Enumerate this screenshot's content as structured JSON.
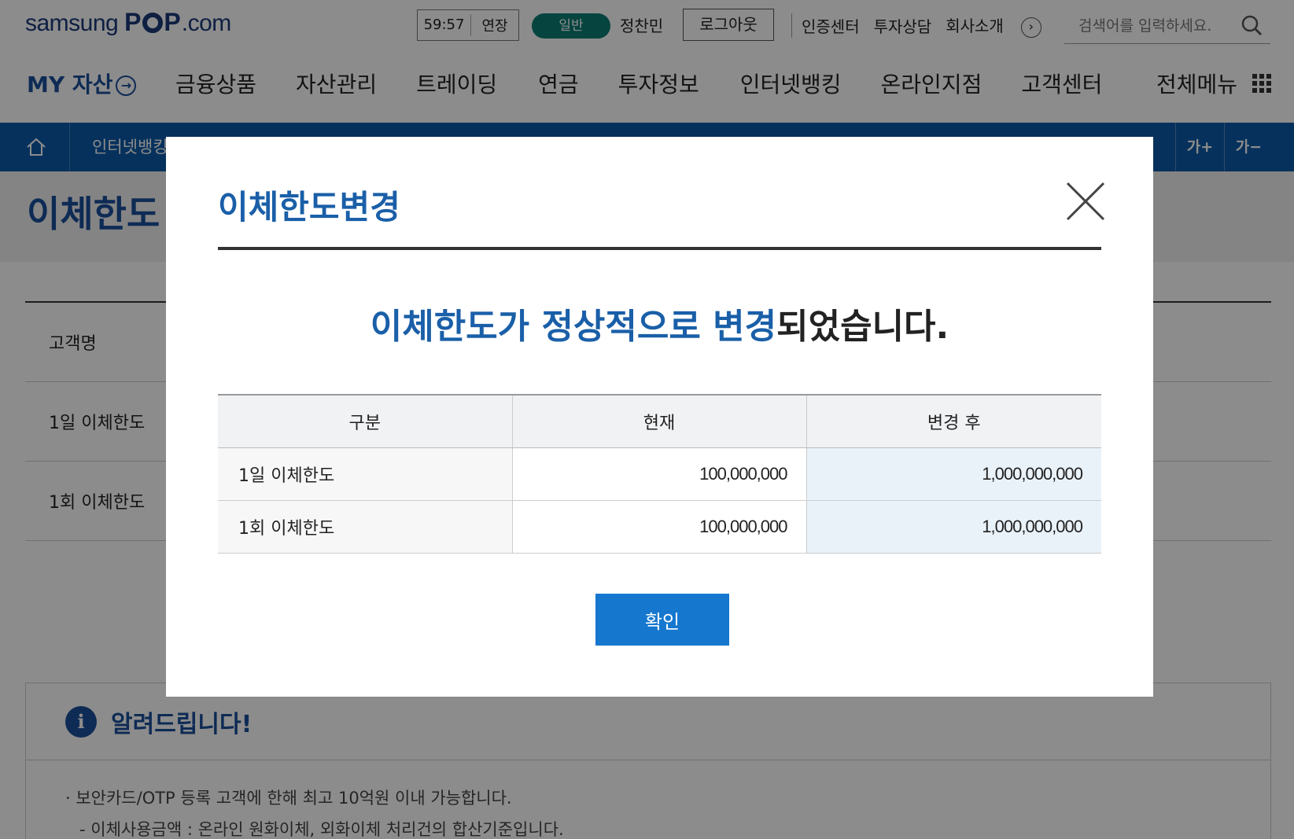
{
  "header": {
    "logo": "samsung POP.com",
    "logo_prefix": "samsung ",
    "logo_p1": "P",
    "logo_p2": "P",
    "logo_suffix": ".com",
    "session_timer": "59:57",
    "extend_label": "연장",
    "user_grade_badge": "일반",
    "user_name": "정찬민",
    "logout_label": "로그아웃",
    "util_links": [
      "인증센터",
      "투자상담",
      "회사소개"
    ],
    "search_placeholder": "검색어를 입력하세요."
  },
  "gnb": {
    "my_asset_label": "MY 자산",
    "menu": [
      "금융상품",
      "자산관리",
      "트레이딩",
      "연금",
      "투자정보",
      "인터넷뱅킹",
      "온라인지점",
      "고객센터"
    ],
    "all_menu_label": "전체메뉴"
  },
  "location": {
    "crumb": "인터넷뱅킹",
    "font_up": "가+",
    "font_down": "가−"
  },
  "page": {
    "title": "이체한도",
    "rows": [
      "고객명",
      "1일 이체한도",
      "1회 이체한도"
    ],
    "notice_title": "알려드립니다!",
    "notice_items": [
      "· 보안카드/OTP 등록 고객에 한해 최고 10억원 이내 가능합니다.",
      "- 이체사용금액 : 온라인 원화이체, 외화이체 처리건의 합산기준입니다."
    ]
  },
  "modal": {
    "title": "이체한도변경",
    "message_highlight": "이체한도가 정상적으로 변경",
    "message_rest": "되었습니다.",
    "table": {
      "headers": [
        "구분",
        "현재",
        "변경 후"
      ],
      "rows": [
        {
          "label": "1일 이체한도",
          "current": "100,000,000",
          "after": "1,000,000,000"
        },
        {
          "label": "1회 이체한도",
          "current": "100,000,000",
          "after": "1,000,000,000"
        }
      ]
    },
    "confirm_label": "확인"
  }
}
